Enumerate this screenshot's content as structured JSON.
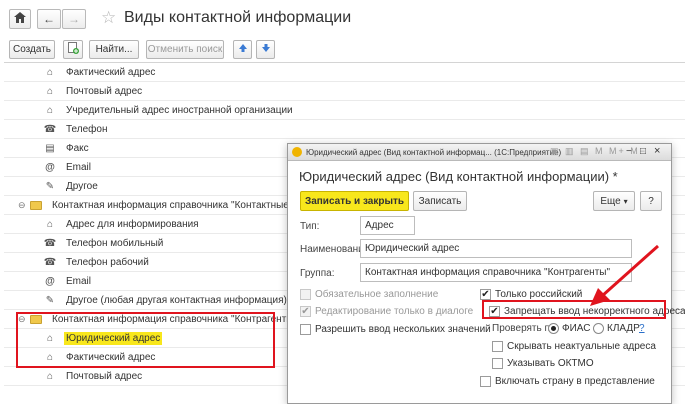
{
  "header": {
    "home_icon": "home-icon",
    "back_icon": "arrow-left-icon",
    "forward_icon": "arrow-right-icon",
    "favorite_icon": "star-icon",
    "title": "Виды контактной информации"
  },
  "toolbar": {
    "create": "Создать",
    "find": "Найти...",
    "cancel_search": "Отменить поиск"
  },
  "list": {
    "rows": [
      {
        "text": "Фактический адрес",
        "icon": "house-icon"
      },
      {
        "text": "Почтовый адрес",
        "icon": "house-icon"
      },
      {
        "text": "Учредительный адрес иностранной организации",
        "icon": "house-icon"
      },
      {
        "text": "Телефон",
        "icon": "phone-icon"
      },
      {
        "text": "Факс",
        "icon": "fax-icon"
      },
      {
        "text": "Email",
        "icon": "at-icon"
      },
      {
        "text": "Другое",
        "icon": "note-icon"
      },
      {
        "text": "Контактная информация справочника \"Контактные лица\"",
        "icon": "folder-icon"
      },
      {
        "text": "Адрес для информирования",
        "icon": "house-icon"
      },
      {
        "text": "Телефон мобильный",
        "icon": "phone-icon"
      },
      {
        "text": "Телефон рабочий",
        "icon": "phone-icon"
      },
      {
        "text": "Email",
        "icon": "at-icon"
      },
      {
        "text": "Другое (любая другая контактная информация)",
        "icon": "note-icon"
      },
      {
        "text": "Контактная информация справочника \"Контрагенты\"",
        "icon": "folder-icon"
      },
      {
        "text": "Юридический адрес",
        "icon": "house-icon"
      },
      {
        "text": "Фактический адрес",
        "icon": "house-icon"
      },
      {
        "text": "Почтовый адрес",
        "icon": "house-icon"
      }
    ]
  },
  "dialog": {
    "window_title": "Юридический адрес (Вид контактной информац... (1С:Предприятие)",
    "title": "Юридический адрес (Вид контактной информации) *",
    "save_close": "Записать и закрыть",
    "save": "Записать",
    "more": "Еще",
    "help": "?",
    "type_label": "Тип:",
    "type_value": "Адрес",
    "name_label": "Наименование:",
    "name_value": "Юридический адрес",
    "group_label": "Группа:",
    "group_value": "Контактная информация справочника \"Контрагенты\"",
    "required": "Обязательное заполнение",
    "edit_dialog_only": "Редактирование только в диалоге",
    "allow_multiple": "Разрешить ввод нескольких значений",
    "only_russian": "Только российский",
    "forbid_incorrect": "Запрещать ввод некорректного адреса",
    "check_by": "Проверять по:",
    "fias": "ФИАС",
    "kladr": "КЛАДР",
    "kladr_help": "?",
    "hide_obsolete": "Скрывать неактуальные адреса",
    "show_oktmo": "Указывать ОКТМО",
    "include_country": "Включать страну в представление"
  },
  "colors": {
    "accent_yellow": "#f8e71c",
    "highlight_red": "#e0141e"
  }
}
